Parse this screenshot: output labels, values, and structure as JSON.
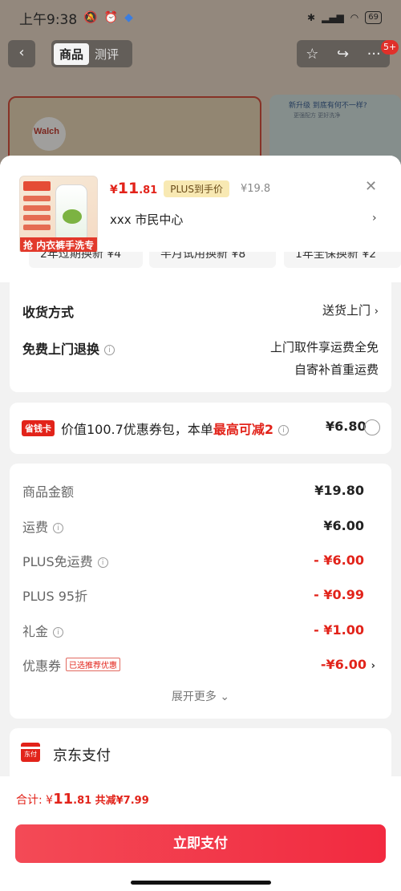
{
  "status": {
    "time": "上午9:38",
    "battery": "69"
  },
  "nav": {
    "tabs": [
      "商品",
      "测评"
    ],
    "badge": "5+"
  },
  "background": {
    "brand": "Walch",
    "side_title": "新升级 到底有何不一样?",
    "side_sub": "更强配方 更好洗净"
  },
  "product": {
    "currency": "¥",
    "price_int": "11",
    "price_dec": ".81",
    "plus_tag": "PLUS到手价",
    "original_price": "¥19.8",
    "address": "xxx  市民中心",
    "thumb_banner": "抢 内衣裤手洗专用"
  },
  "services": [
    "2年过期换新 ¥4",
    "半月试用换新 ¥8",
    "1年全保换新 ¥2"
  ],
  "delivery": {
    "label": "收货方式",
    "value": "送货上门",
    "return_label": "免费上门退换",
    "return_line1": "上门取件享运费全免",
    "return_line2": "自寄补首重运费"
  },
  "saver": {
    "tag": "省钱卡",
    "text_prefix": "价值100.7优惠券包，本单",
    "text_highlight": "最高可减2",
    "amount": "¥6.80"
  },
  "breakdown": [
    {
      "label": "商品金额",
      "value": "¥19.80",
      "info": false,
      "red": false
    },
    {
      "label": "运费",
      "value": "¥6.00",
      "info": true,
      "red": false
    },
    {
      "label": "PLUS免运费",
      "value": "- ¥6.00",
      "info": true,
      "red": true
    },
    {
      "label": "PLUS 95折",
      "value": "- ¥0.99",
      "info": false,
      "red": true
    },
    {
      "label": "礼金",
      "value": "- ¥1.00",
      "info": true,
      "red": true
    },
    {
      "label": "优惠券",
      "value": "-¥6.00",
      "info": false,
      "red": true
    }
  ],
  "coupon_tag": "已选推荐优惠",
  "expand": "展开更多",
  "payment": {
    "icon_text": "东付",
    "label": "京东支付"
  },
  "bottom": {
    "total_label": "合计: ",
    "currency": "¥",
    "total_int": "11",
    "total_dec": ".81",
    "saved": "共减¥7.99",
    "pay_button": "立即支付"
  }
}
